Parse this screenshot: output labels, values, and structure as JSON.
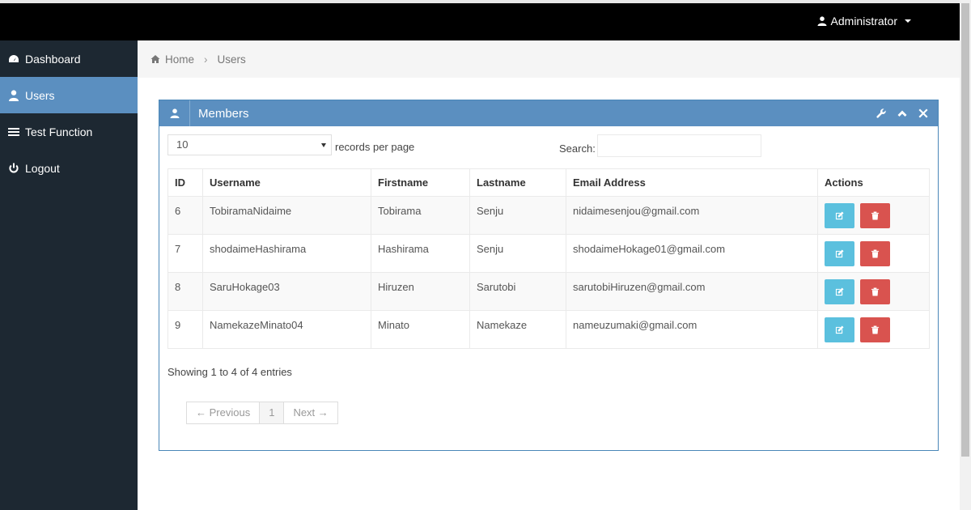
{
  "topbar": {
    "user_label": "Administrator",
    "user_icon": "user-icon"
  },
  "sidebar": {
    "items": [
      {
        "label": "Dashboard",
        "icon": "dashboard-icon",
        "active": false
      },
      {
        "label": "Users",
        "icon": "user-icon",
        "active": true
      },
      {
        "label": "Test Function",
        "icon": "list-icon",
        "active": false
      },
      {
        "label": "Logout",
        "icon": "power-icon",
        "active": false
      }
    ]
  },
  "breadcrumb": {
    "home": "Home",
    "current": "Users"
  },
  "panel": {
    "title": "Members",
    "length_value": "10",
    "length_label": "records per page",
    "search_label": "Search:",
    "search_value": "",
    "columns": [
      "ID",
      "Username",
      "Firstname",
      "Lastname",
      "Email Address",
      "Actions"
    ],
    "rows": [
      {
        "id": "6",
        "username": "TobiramaNidaime",
        "firstname": "Tobirama",
        "lastname": "Senju",
        "email": "nidaimesenjou@gmail.com"
      },
      {
        "id": "7",
        "username": "shodaimeHashirama",
        "firstname": "Hashirama",
        "lastname": "Senju",
        "email": "shodaimeHokage01@gmail.com"
      },
      {
        "id": "8",
        "username": "SaruHokage03",
        "firstname": "Hiruzen",
        "lastname": "Sarutobi",
        "email": "sarutobiHiruzen@gmail.com"
      },
      {
        "id": "9",
        "username": "NamekazeMinato04",
        "firstname": "Minato",
        "lastname": "Namekaze",
        "email": "nameuzumaki@gmail.com"
      }
    ],
    "info": "Showing 1 to 4 of 4 entries",
    "pagination": {
      "prev": "← Previous",
      "page": "1",
      "next": "Next →"
    }
  },
  "colors": {
    "topbar": "#000000",
    "sidebar": "#1d2832",
    "accent": "#5b8fc0",
    "edit_button": "#5bc0de",
    "delete_button": "#d9534f"
  }
}
